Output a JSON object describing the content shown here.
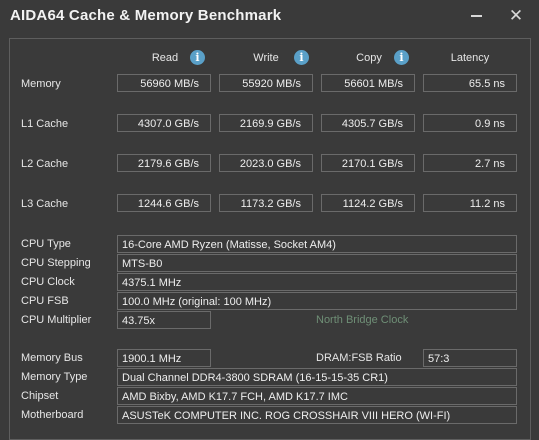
{
  "window": {
    "title": "AIDA64 Cache & Memory Benchmark"
  },
  "columns": {
    "read": "Read",
    "write": "Write",
    "copy": "Copy",
    "latency": "Latency"
  },
  "rows": {
    "memory": {
      "label": "Memory",
      "read": "56960 MB/s",
      "write": "55920 MB/s",
      "copy": "56601 MB/s",
      "latency": "65.5 ns"
    },
    "l1": {
      "label": "L1 Cache",
      "read": "4307.0 GB/s",
      "write": "2169.9 GB/s",
      "copy": "4305.7 GB/s",
      "latency": "0.9 ns"
    },
    "l2": {
      "label": "L2 Cache",
      "read": "2179.6 GB/s",
      "write": "2023.0 GB/s",
      "copy": "2170.1 GB/s",
      "latency": "2.7 ns"
    },
    "l3": {
      "label": "L3 Cache",
      "read": "1244.6 GB/s",
      "write": "1173.2 GB/s",
      "copy": "1124.2 GB/s",
      "latency": "11.2 ns"
    }
  },
  "cpu": {
    "type": {
      "label": "CPU Type",
      "value": "16-Core AMD Ryzen  (Matisse, Socket AM4)"
    },
    "stepping": {
      "label": "CPU Stepping",
      "value": "MTS-B0"
    },
    "clock": {
      "label": "CPU Clock",
      "value": "4375.1 MHz"
    },
    "fsb": {
      "label": "CPU FSB",
      "value": "100.0 MHz  (original: 100 MHz)"
    },
    "multiplier": {
      "label": "CPU Multiplier",
      "value": "43.75x"
    },
    "north_bridge_label": "North Bridge Clock"
  },
  "memory_info": {
    "bus": {
      "label": "Memory Bus",
      "value": "1900.1 MHz"
    },
    "dram_ratio": {
      "label": "DRAM:FSB Ratio",
      "value": "57:3"
    },
    "type": {
      "label": "Memory Type",
      "value": "Dual Channel DDR4-3800 SDRAM  (16-15-15-35 CR1)"
    },
    "chipset": {
      "label": "Chipset",
      "value": "AMD Bixby, AMD K17.7 FCH, AMD K17.7 IMC"
    },
    "motherboard": {
      "label": "Motherboard",
      "value": "ASUSTeK COMPUTER INC. ROG CROSSHAIR VIII HERO (WI-FI)"
    }
  },
  "icons": {
    "info": "info-icon",
    "minimize": "minimize-icon",
    "close": "close-icon"
  },
  "colors": {
    "background": "#3a3a3a",
    "info_accent": "#5aa0c8",
    "disabled_text": "#6f8f76"
  }
}
